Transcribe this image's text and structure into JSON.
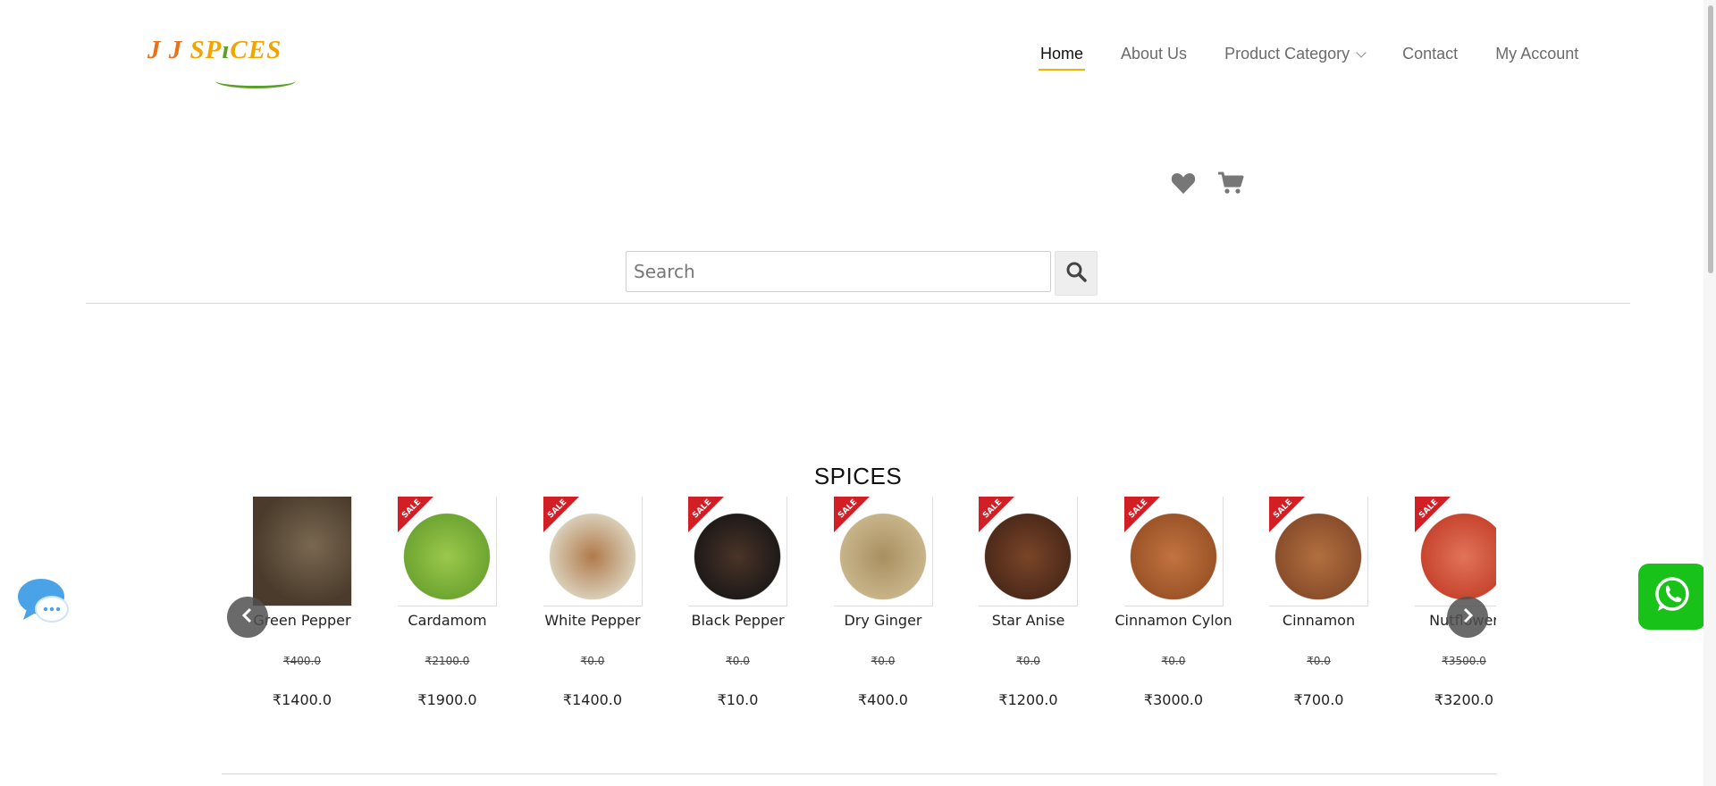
{
  "brand": {
    "logo_text_a": "J J ",
    "logo_text_b": "SP",
    "logo_text_c": "CES"
  },
  "nav": {
    "items": [
      {
        "label": "Home",
        "active": true
      },
      {
        "label": "About Us"
      },
      {
        "label": "Product Category",
        "has_dropdown": true
      },
      {
        "label": "Contact"
      },
      {
        "label": "My Account"
      }
    ]
  },
  "header_icons": [
    "heart-icon",
    "cart-icon"
  ],
  "search": {
    "placeholder": "Search",
    "value": ""
  },
  "section": {
    "title": "SPICES"
  },
  "products": [
    {
      "name": "Green Pepper",
      "old_price": "₹400.0",
      "price": "₹1400.0",
      "sale": false,
      "colors": [
        "#4a3b2c",
        "#7a6850"
      ]
    },
    {
      "name": "Cardamom",
      "old_price": "₹2100.0",
      "price": "₹1900.0",
      "sale": true,
      "colors": [
        "#6fa532",
        "#9bc84c"
      ]
    },
    {
      "name": "White Pepper",
      "old_price": "₹0.0",
      "price": "₹1400.0",
      "sale": true,
      "colors": [
        "#d9cdb7",
        "#b07a4a"
      ]
    },
    {
      "name": "Black Pepper",
      "old_price": "₹0.0",
      "price": "₹10.0",
      "sale": true,
      "colors": [
        "#1f1a18",
        "#4a3428"
      ]
    },
    {
      "name": "Dry Ginger",
      "old_price": "₹0.0",
      "price": "₹400.0",
      "sale": true,
      "colors": [
        "#c8b48a",
        "#a88f60"
      ]
    },
    {
      "name": "Star Anise",
      "old_price": "₹0.0",
      "price": "₹1200.0",
      "sale": true,
      "colors": [
        "#4d2a1a",
        "#7a4528"
      ]
    },
    {
      "name": "Cinnamon Cylon",
      "old_price": "₹0.0",
      "price": "₹3000.0",
      "sale": true,
      "colors": [
        "#9c5428",
        "#c27440"
      ]
    },
    {
      "name": "Cinnamon",
      "old_price": "₹0.0",
      "price": "₹700.0",
      "sale": true,
      "colors": [
        "#8a4e2c",
        "#b3703f"
      ]
    },
    {
      "name": "Nutflower",
      "old_price": "₹3500.0",
      "price": "₹3200.0",
      "sale": true,
      "colors": [
        "#c8452e",
        "#e0745a"
      ]
    }
  ],
  "colors": {
    "accent": "#f2b400",
    "sale_red": "#d21f26",
    "whatsapp_green": "#19c218",
    "chat_blue": "#4aa3e6"
  }
}
